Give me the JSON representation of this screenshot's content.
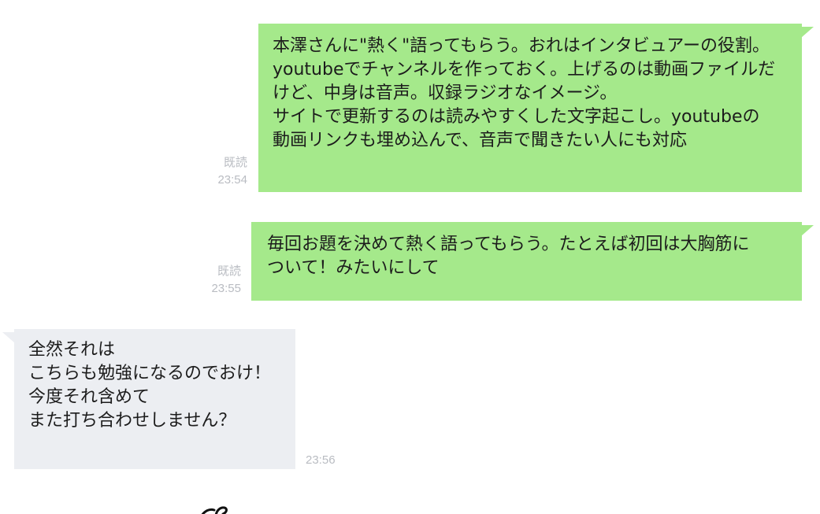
{
  "messages": [
    {
      "direction": "outgoing",
      "text": "本澤さんに\"熱く\"語ってもらう。おれはインタビュアーの役割。\nyoutubeでチャンネルを作っておく。上げるのは動画ファイルだ\nけど、中身は音声。収録ラジオなイメージ。\nサイトで更新するのは読みやすくした文字起こし。youtubeの\n動画リンクも埋め込んで、音声で聞きたい人にも対応",
      "read_label": "既読",
      "time": "23:54"
    },
    {
      "direction": "outgoing",
      "text": "毎回お題を決めて熱く語ってもらう。たとえば初回は大胸筋に\nついて！みたいにして",
      "read_label": "既読",
      "time": "23:55"
    },
    {
      "direction": "incoming",
      "text": "全然それは\nこちらも勉強になるのでおけ！\n今度それ含めて\nまた打ち合わせしません？",
      "time": "23:56"
    }
  ],
  "colors": {
    "outgoing_bubble": "#a5e98b",
    "incoming_bubble": "#eceef2",
    "meta_text": "#b9bcc2"
  }
}
